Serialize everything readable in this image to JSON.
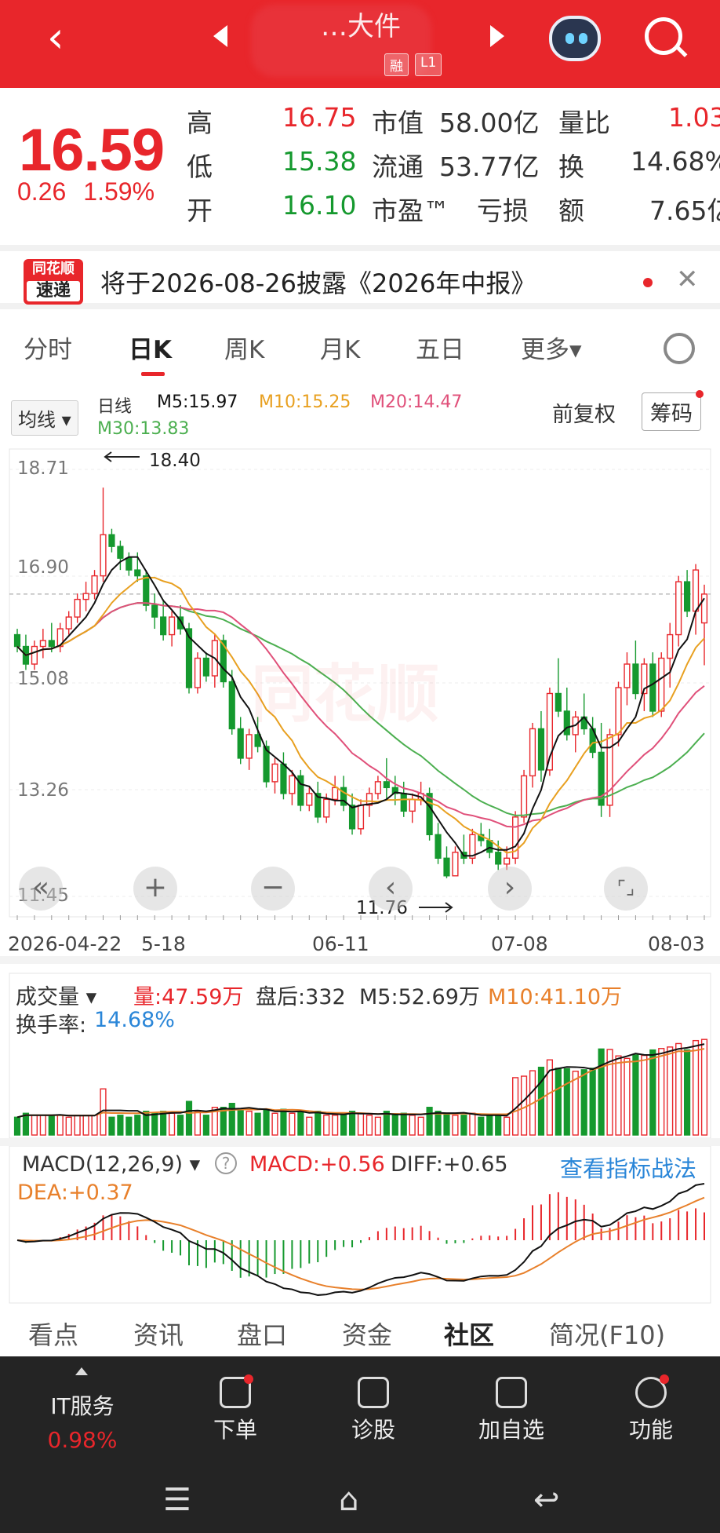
{
  "header": {
    "title": "…大件",
    "badges": [
      "融",
      "L1"
    ],
    "back_icon": "back-arrow-icon",
    "assistant_icon": "robot-assistant-icon",
    "search_icon": "search-icon"
  },
  "quote": {
    "price": "16.59",
    "change": "0.26",
    "change_pct": "1.59%",
    "rows": [
      {
        "l1": "高",
        "v1": "16.75",
        "l2": "市值",
        "v2": "58.00亿",
        "l3": "量比",
        "v3": "1.03"
      },
      {
        "l1": "低",
        "v1": "15.38",
        "l2": "流通",
        "v2": "53.77亿",
        "l3": "换",
        "v3": "14.68%"
      },
      {
        "l1": "开",
        "v1": "16.10",
        "l2": "市盈™",
        "v2": "亏损",
        "l3": "额",
        "v3": "7.65亿"
      }
    ]
  },
  "notice": {
    "logo_top": "同花顺",
    "logo_bottom": "速递",
    "text": "将于2026-08-26披露《2026年中报》"
  },
  "tabs": [
    "分时",
    "日K",
    "周K",
    "月K",
    "五日",
    "更多▾"
  ],
  "ma_bar": {
    "toggle": "均线 ▾",
    "period": "日线",
    "m5": "M5:15.97",
    "m10": "M10:15.25",
    "m20": "M20:14.47",
    "m30": "M30:13.83",
    "fuquan": "前复权",
    "chouma": "筹码"
  },
  "kchart": {
    "y_labels": [
      "18.71",
      "16.90",
      "15.08",
      "13.26",
      "11.45"
    ],
    "high_marker": "18.40",
    "low_marker": "11.76",
    "x_labels": [
      "2026-04-22",
      "5-18",
      "06-11",
      "07-08",
      "08-03"
    ],
    "watermark": "同花顺",
    "controls": [
      "«",
      "+",
      "−",
      "‹",
      "›",
      "⌜⌟"
    ]
  },
  "volume": {
    "toggle": "成交量 ▾",
    "vol": "量:47.59万",
    "after": "盘后:332",
    "m5": "M5:52.69万",
    "m10": "M10:41.10万",
    "turnover_label": "换手率:",
    "turnover": "14.68%"
  },
  "macd": {
    "toggle": "MACD(12,26,9) ▾",
    "help": "?",
    "macd": "MACD:+0.56",
    "diff": "DIFF:+0.65",
    "dea": "DEA:+0.37",
    "link": "查看指标战法"
  },
  "bottom": {
    "subtabs": [
      "看点",
      "资讯",
      "盘口",
      "资金",
      "社区",
      "简况(F10)"
    ],
    "sector": "IT服务",
    "sector_pct": "0.98%",
    "buttons": [
      "下单",
      "诊股",
      "加自选",
      "功能"
    ]
  },
  "colors": {
    "up": "#e8262b",
    "down": "#15992e",
    "m5": "#111111",
    "m10": "#e8a020",
    "m20": "#e0507a",
    "m30": "#4caf50"
  },
  "chart_data": {
    "type": "candlestick",
    "title": "日K",
    "ylim": [
      11.45,
      18.71
    ],
    "ohlc": [
      [
        15.9,
        16.0,
        15.6,
        15.7
      ],
      [
        15.7,
        15.9,
        15.3,
        15.4
      ],
      [
        15.4,
        15.8,
        15.3,
        15.7
      ],
      [
        15.7,
        16.0,
        15.5,
        15.8
      ],
      [
        15.8,
        16.1,
        15.6,
        15.7
      ],
      [
        15.7,
        16.1,
        15.6,
        16.0
      ],
      [
        16.0,
        16.3,
        15.9,
        16.2
      ],
      [
        16.2,
        16.6,
        16.1,
        16.5
      ],
      [
        16.5,
        16.8,
        16.3,
        16.6
      ],
      [
        16.6,
        17.0,
        16.5,
        16.9
      ],
      [
        16.9,
        18.4,
        16.8,
        17.6
      ],
      [
        17.6,
        17.7,
        17.3,
        17.4
      ],
      [
        17.4,
        17.5,
        17.0,
        17.2
      ],
      [
        17.2,
        17.3,
        16.9,
        17.0
      ],
      [
        17.0,
        17.3,
        16.8,
        16.9
      ],
      [
        16.9,
        17.0,
        16.3,
        16.4
      ],
      [
        16.4,
        16.6,
        16.0,
        16.2
      ],
      [
        16.2,
        16.5,
        15.8,
        15.9
      ],
      [
        15.9,
        16.3,
        15.7,
        16.2
      ],
      [
        16.2,
        16.4,
        15.9,
        16.0
      ],
      [
        16.0,
        16.1,
        14.9,
        15.0
      ],
      [
        15.0,
        15.6,
        14.9,
        15.5
      ],
      [
        15.5,
        15.6,
        15.1,
        15.2
      ],
      [
        15.2,
        15.9,
        15.0,
        15.8
      ],
      [
        15.8,
        15.9,
        15.0,
        15.1
      ],
      [
        15.1,
        15.3,
        14.2,
        14.3
      ],
      [
        14.3,
        14.5,
        13.7,
        13.8
      ],
      [
        13.8,
        14.3,
        13.6,
        14.2
      ],
      [
        14.2,
        14.5,
        13.9,
        14.0
      ],
      [
        14.0,
        14.1,
        13.3,
        13.4
      ],
      [
        13.4,
        13.8,
        13.2,
        13.7
      ],
      [
        13.7,
        13.9,
        13.1,
        13.2
      ],
      [
        13.2,
        13.6,
        13.0,
        13.5
      ],
      [
        13.5,
        13.6,
        12.9,
        13.0
      ],
      [
        13.0,
        13.3,
        12.9,
        13.2
      ],
      [
        13.2,
        13.4,
        12.7,
        12.8
      ],
      [
        12.8,
        13.2,
        12.7,
        13.1
      ],
      [
        13.1,
        13.5,
        13.0,
        13.3
      ],
      [
        13.3,
        13.5,
        12.9,
        13.0
      ],
      [
        13.0,
        13.2,
        12.5,
        12.6
      ],
      [
        12.6,
        13.1,
        12.5,
        13.0
      ],
      [
        13.0,
        13.3,
        12.8,
        13.2
      ],
      [
        13.2,
        13.5,
        13.1,
        13.4
      ],
      [
        13.4,
        13.8,
        13.1,
        13.3
      ],
      [
        13.3,
        13.5,
        13.0,
        13.2
      ],
      [
        13.2,
        13.4,
        12.8,
        12.9
      ],
      [
        12.9,
        13.2,
        12.7,
        13.1
      ],
      [
        13.1,
        13.4,
        13.0,
        13.2
      ],
      [
        13.2,
        13.3,
        12.4,
        12.5
      ],
      [
        12.5,
        12.7,
        12.0,
        12.1
      ],
      [
        12.1,
        12.3,
        11.76,
        11.8
      ],
      [
        11.8,
        12.3,
        11.8,
        12.2
      ],
      [
        12.2,
        12.5,
        12.0,
        12.1
      ],
      [
        12.1,
        12.6,
        12.0,
        12.5
      ],
      [
        12.5,
        12.7,
        12.3,
        12.4
      ],
      [
        12.4,
        12.6,
        12.1,
        12.2
      ],
      [
        12.2,
        12.4,
        11.9,
        12.0
      ],
      [
        12.0,
        12.3,
        11.9,
        12.1
      ],
      [
        12.1,
        12.9,
        12.0,
        12.8
      ],
      [
        12.8,
        13.6,
        12.7,
        13.5
      ],
      [
        13.5,
        14.4,
        13.3,
        14.3
      ],
      [
        14.3,
        14.6,
        13.4,
        13.6
      ],
      [
        13.6,
        15.0,
        13.5,
        14.9
      ],
      [
        14.9,
        15.5,
        14.5,
        14.6
      ],
      [
        14.6,
        15.0,
        14.1,
        14.2
      ],
      [
        14.2,
        14.6,
        13.9,
        14.5
      ],
      [
        14.5,
        14.9,
        14.2,
        14.3
      ],
      [
        14.3,
        14.5,
        13.8,
        13.9
      ],
      [
        13.9,
        14.4,
        12.8,
        13.0
      ],
      [
        13.0,
        14.3,
        12.8,
        14.2
      ],
      [
        14.2,
        15.1,
        14.0,
        15.0
      ],
      [
        15.0,
        15.6,
        14.7,
        15.4
      ],
      [
        15.4,
        15.8,
        14.8,
        14.9
      ],
      [
        14.9,
        15.5,
        14.6,
        15.4
      ],
      [
        15.4,
        15.6,
        14.5,
        14.6
      ],
      [
        14.6,
        15.6,
        14.5,
        15.5
      ],
      [
        15.5,
        16.1,
        15.0,
        15.9
      ],
      [
        15.9,
        16.9,
        15.7,
        16.8
      ],
      [
        16.8,
        17.0,
        16.2,
        16.3
      ],
      [
        16.3,
        17.1,
        15.9,
        17.0
      ],
      [
        16.1,
        16.75,
        15.38,
        16.59
      ]
    ],
    "ma5_last": 15.97,
    "ma10_last": 15.25,
    "ma20_last": 14.47,
    "ma30_last": 13.83,
    "volume_ylim": [
      0,
      60
    ],
    "macd": {
      "macd": 0.56,
      "diff": 0.65,
      "dea": 0.37
    }
  }
}
